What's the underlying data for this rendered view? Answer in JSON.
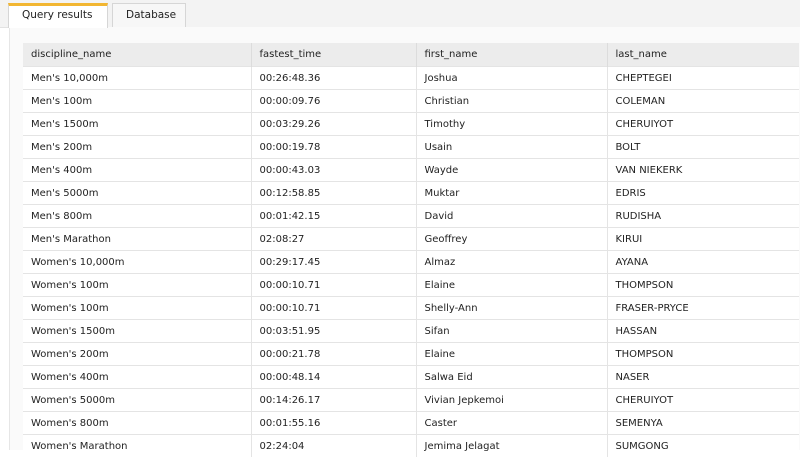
{
  "tabs": {
    "query_results": "Query results",
    "database": "Database"
  },
  "colors": {
    "active_tab_accent": "#f2b632",
    "header_bg": "#ececec",
    "tabbar_bg": "#f3f3f3"
  },
  "table": {
    "columns": [
      "discipline_name",
      "fastest_time",
      "first_name",
      "last_name"
    ],
    "rows": [
      [
        "Men's 10,000m",
        "00:26:48.36",
        "Joshua",
        "CHEPTEGEI"
      ],
      [
        "Men's 100m",
        "00:00:09.76",
        "Christian",
        "COLEMAN"
      ],
      [
        "Men's 1500m",
        "00:03:29.26",
        "Timothy",
        "CHERUIYOT"
      ],
      [
        "Men's 200m",
        "00:00:19.78",
        "Usain",
        "BOLT"
      ],
      [
        "Men's 400m",
        "00:00:43.03",
        "Wayde",
        "VAN NIEKERK"
      ],
      [
        "Men's 5000m",
        "00:12:58.85",
        "Muktar",
        "EDRIS"
      ],
      [
        "Men's 800m",
        "00:01:42.15",
        "David",
        "RUDISHA"
      ],
      [
        "Men's Marathon",
        "02:08:27",
        "Geoffrey",
        "KIRUI"
      ],
      [
        "Women's 10,000m",
        "00:29:17.45",
        "Almaz",
        "AYANA"
      ],
      [
        "Women's 100m",
        "00:00:10.71",
        "Elaine",
        "THOMPSON"
      ],
      [
        "Women's 100m",
        "00:00:10.71",
        "Shelly-Ann",
        "FRASER-PRYCE"
      ],
      [
        "Women's 1500m",
        "00:03:51.95",
        "Sifan",
        "HASSAN"
      ],
      [
        "Women's 200m",
        "00:00:21.78",
        "Elaine",
        "THOMPSON"
      ],
      [
        "Women's 400m",
        "00:00:48.14",
        "Salwa Eid",
        "NASER"
      ],
      [
        "Women's 5000m",
        "00:14:26.17",
        "Vivian Jepkemoi",
        "CHERUIYOT"
      ],
      [
        "Women's 800m",
        "00:01:55.16",
        "Caster",
        "SEMENYA"
      ],
      [
        "Women's Marathon",
        "02:24:04",
        "Jemima Jelagat",
        "SUMGONG"
      ]
    ]
  }
}
